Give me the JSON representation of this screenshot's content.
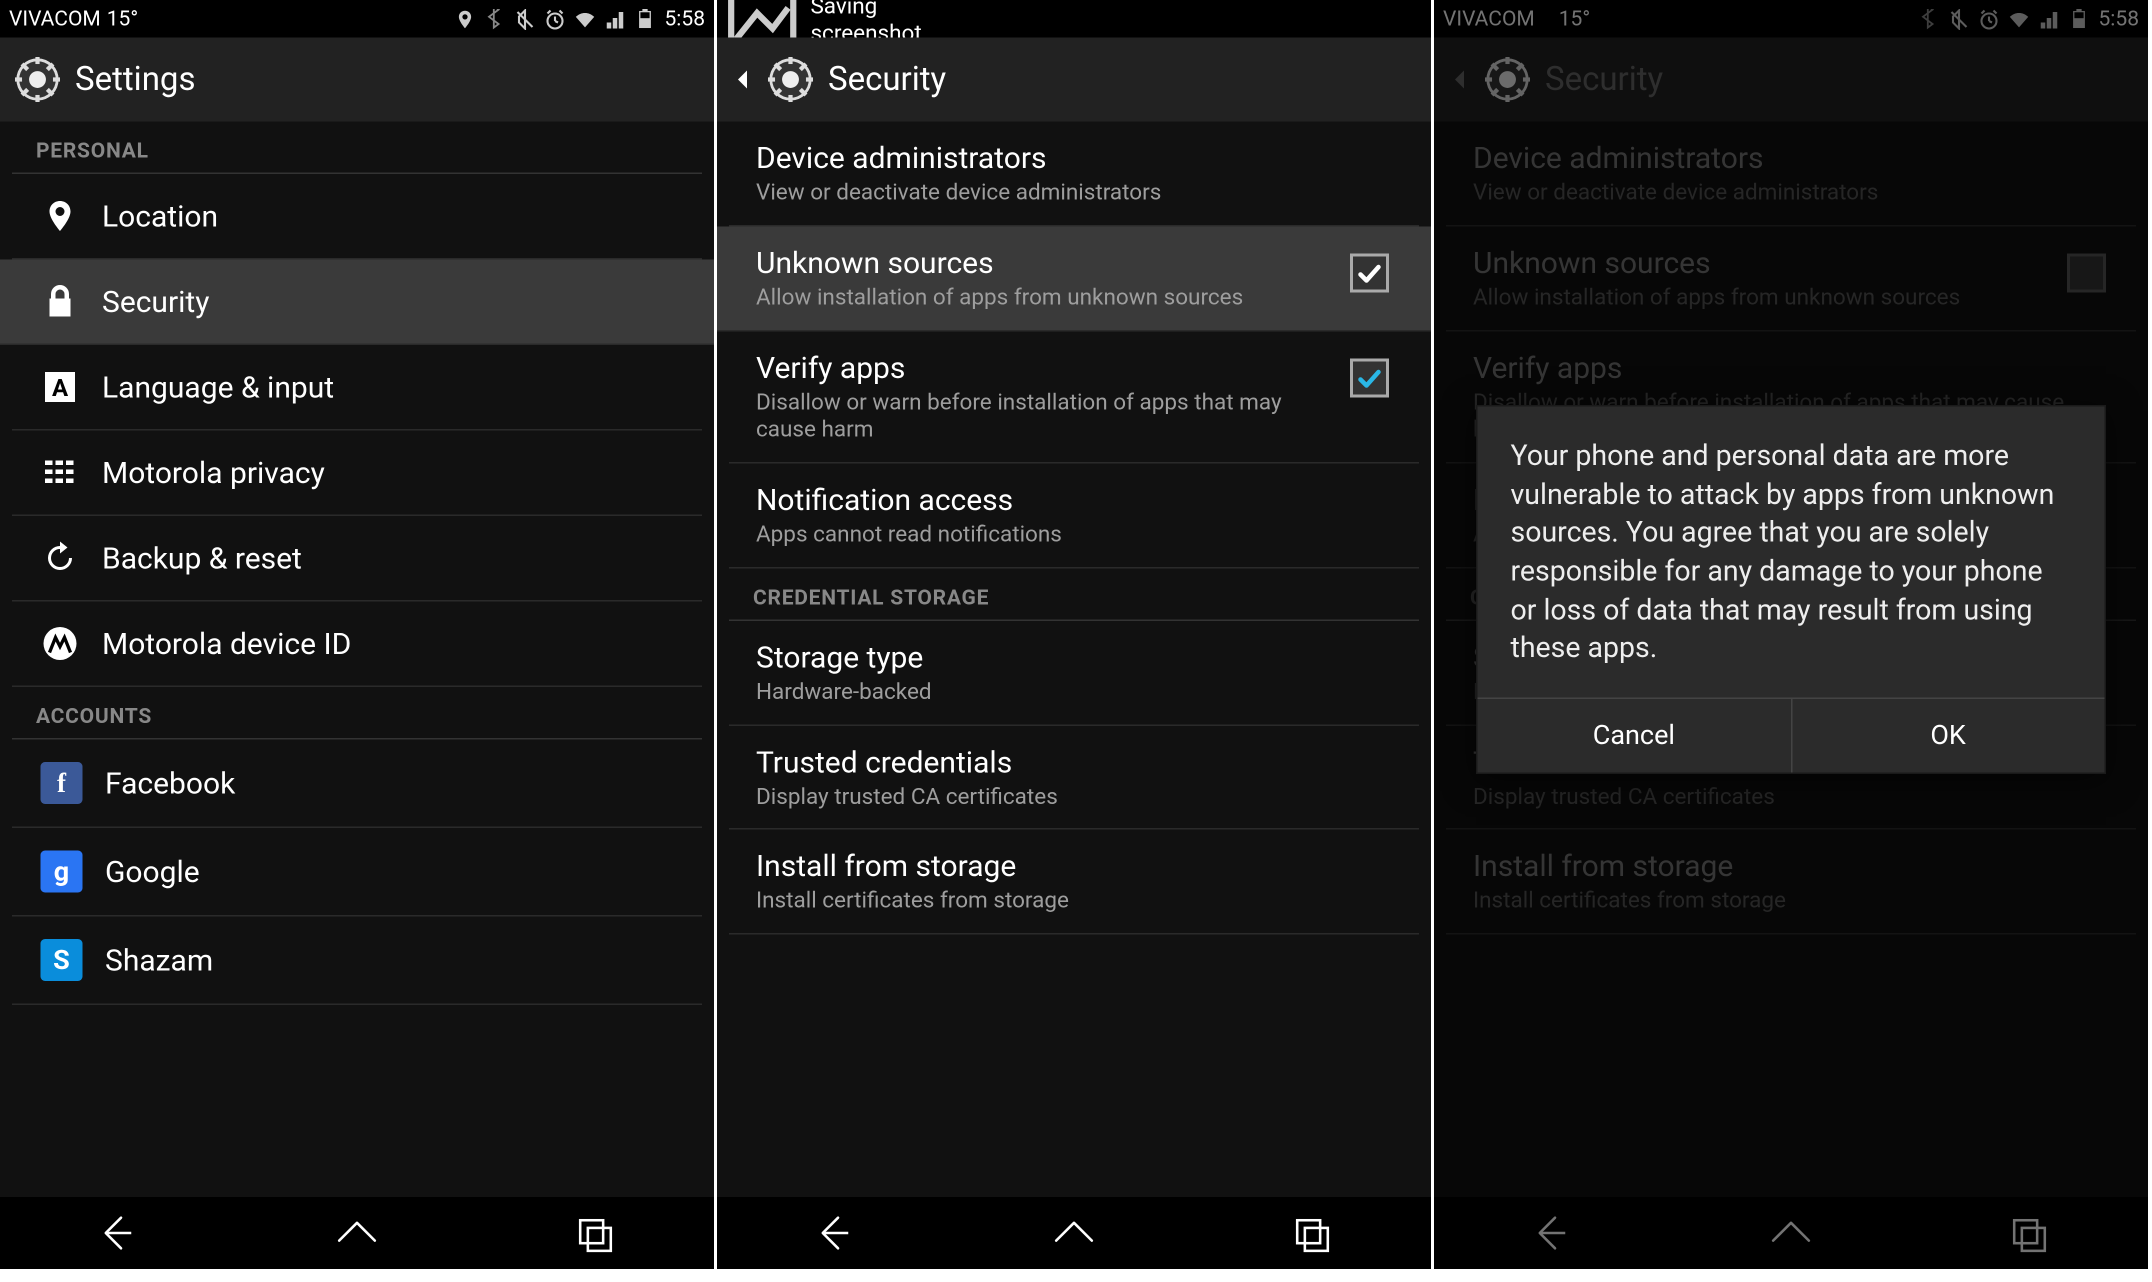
{
  "status1": {
    "carrier": "VIVACOM",
    "temp": "15°",
    "time": "5:58",
    "notif_text": "Saving screenshot…"
  },
  "status3": {
    "carrier": "VIVACOM",
    "temp": "15°",
    "time": "5:58"
  },
  "settings": {
    "title": "Settings",
    "section_personal": "PERSONAL",
    "section_accounts": "ACCOUNTS",
    "items": [
      {
        "label": "Location"
      },
      {
        "label": "Security"
      },
      {
        "label": "Language & input"
      },
      {
        "label": "Motorola privacy"
      },
      {
        "label": "Backup & reset"
      },
      {
        "label": "Motorola device ID"
      }
    ],
    "accounts": [
      {
        "label": "Facebook",
        "color": "#3b5998",
        "letter": "f"
      },
      {
        "label": "Google",
        "color": "#2a75f3",
        "letter": "g"
      },
      {
        "label": "Shazam",
        "color": "#0a8ddb",
        "letter": "S"
      }
    ]
  },
  "security": {
    "title": "Security",
    "section_cred": "CREDENTIAL STORAGE",
    "items": {
      "device_admin": {
        "t": "Device administrators",
        "s": "View or deactivate device administrators"
      },
      "unknown": {
        "t": "Unknown sources",
        "s": "Allow installation of apps from unknown sources"
      },
      "verify": {
        "t": "Verify apps",
        "s": "Disallow or warn before installation of apps that may cause harm"
      },
      "notif": {
        "t": "Notification access",
        "s": "Apps cannot read notifications"
      },
      "storage_type": {
        "t": "Storage type",
        "s": "Hardware-backed"
      },
      "trusted": {
        "t": "Trusted credentials",
        "s": "Display trusted CA certificates"
      },
      "install": {
        "t": "Install from storage",
        "s": "Install certificates from storage"
      }
    }
  },
  "dialog": {
    "body": "Your phone and personal data are more vulnerable to attack by apps from unknown sources. You agree that you are solely responsible for any damage to your phone or loss of data that may result from using these apps.",
    "cancel": "Cancel",
    "ok": "OK"
  }
}
